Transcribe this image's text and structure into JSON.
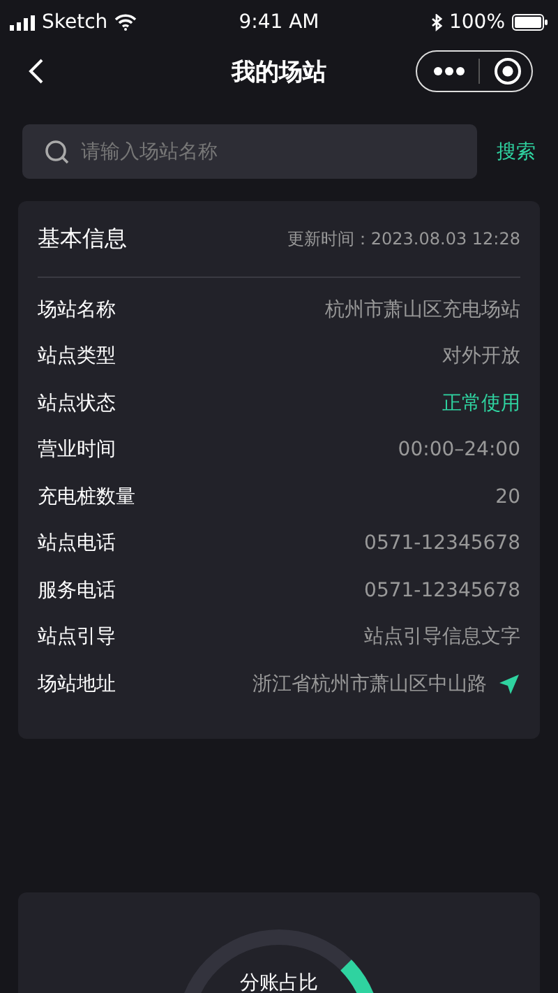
{
  "status_bar": {
    "carrier": "Sketch",
    "time": "9:41 AM",
    "battery": "100%"
  },
  "nav": {
    "title": "我的场站"
  },
  "search": {
    "placeholder": "请输入场站名称",
    "button": "搜索"
  },
  "info_card": {
    "title": "基本信息",
    "updated": "更新时间：2023.08.03 12:28",
    "rows": [
      {
        "label": "场站名称",
        "value": "杭州市萧山区充电场站",
        "kind": "text"
      },
      {
        "label": "站点类型",
        "value": "对外开放",
        "kind": "text"
      },
      {
        "label": "站点状态",
        "value": "正常使用",
        "kind": "status"
      },
      {
        "label": "营业时间",
        "value": "00:00–24:00",
        "kind": "text"
      },
      {
        "label": "充电桩数量",
        "value": "20",
        "kind": "text"
      },
      {
        "label": "站点电话",
        "value": "0571-12345678",
        "kind": "text"
      },
      {
        "label": "服务电话",
        "value": "0571-12345678",
        "kind": "text"
      },
      {
        "label": "站点引导",
        "value": "站点引导信息文字",
        "kind": "text"
      },
      {
        "label": "场站地址",
        "value": "浙江省杭州市萧山区中山路",
        "kind": "location"
      }
    ]
  },
  "share_card": {
    "label": "分账占比"
  }
}
